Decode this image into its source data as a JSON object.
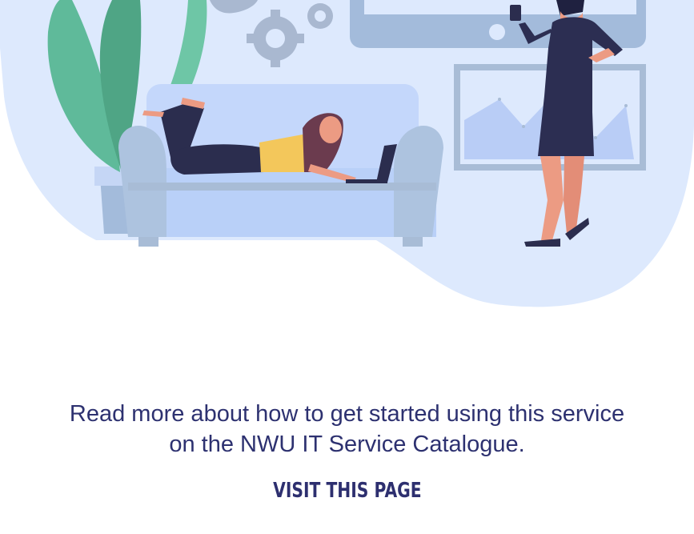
{
  "content": {
    "line1": "Read more about how to get started using this service",
    "line2": "on the NWU IT Service Catalogue.",
    "cta_label": "Visit this page"
  },
  "colors": {
    "text": "#2d3170",
    "blob": "#dde9fd",
    "sofa": "#b5cff7",
    "plant": "#5fba9a"
  },
  "icons": [
    "gear-icon",
    "gear-icon",
    "chart-icon",
    "monitor-icon",
    "plant-icon",
    "sofa-icon",
    "laptop-icon",
    "phone-icon"
  ]
}
